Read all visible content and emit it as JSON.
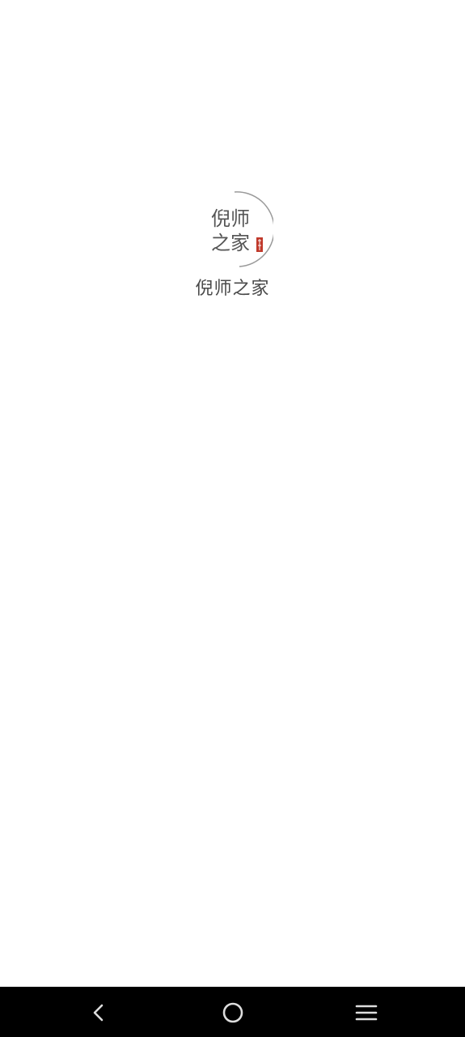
{
  "app": {
    "logo_text_line1": "倪师",
    "logo_text_line2": "之家",
    "logo_seal_text": "",
    "name": "倪师之家"
  },
  "navbar": {
    "back_icon": "back-chevron-icon",
    "home_icon": "home-circle-icon",
    "menu_icon": "menu-lines-icon"
  },
  "colors": {
    "background": "#ffffff",
    "logo_text": "#555555",
    "seal": "#c0392b",
    "arc": "#9a9a9a",
    "navbar": "#000000",
    "nav_icon": "#dddddd"
  }
}
